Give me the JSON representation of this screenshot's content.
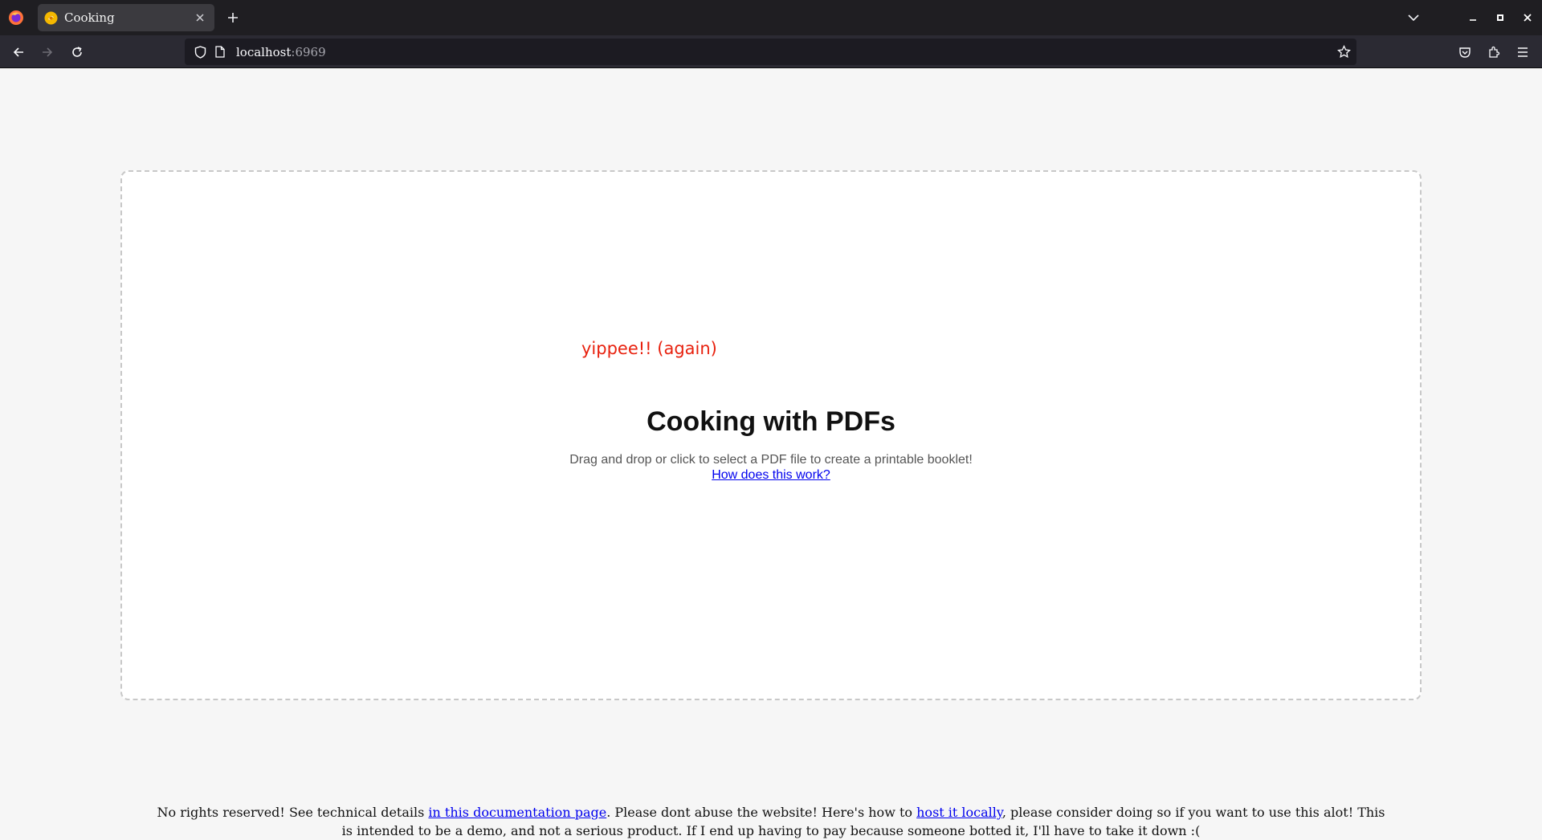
{
  "browser": {
    "tab": {
      "title": "Cooking"
    },
    "url": {
      "host": "localhost",
      "port": ":6969"
    },
    "icons": {
      "firefox_logo": "firefox-icon",
      "favicon": "cooking-favicon-icon",
      "close": "close-icon",
      "new_tab": "plus-icon",
      "tab_list": "chevron-down-icon",
      "back": "back-arrow-icon",
      "forward": "forward-arrow-icon",
      "reload": "reload-icon",
      "tracking": "shield-icon",
      "page": "page-icon",
      "bookmark": "star-icon",
      "pocket": "pocket-icon",
      "extensions": "puzzle-icon",
      "menu": "hamburger-menu-icon"
    }
  },
  "page": {
    "yippee": "yippee!! (again)",
    "title": "Cooking with PDFs",
    "subtitle": "Drag and drop or click to select a PDF file to create a printable booklet!",
    "how_link": "How does this work?",
    "footer": {
      "part1": "No rights reserved! See technical details ",
      "link1": "in this documentation page",
      "part2": ". Please dont abuse the website! Here's how to ",
      "link2": "host it locally",
      "part3": ", please consider doing so if you want to use this alot! This is intended to be a demo, and not a serious product. If I end up having to pay because someone botted it, I'll have to take it down :("
    }
  },
  "colors": {
    "accent_red": "#e8210e",
    "link": "#0000ee",
    "tab_bar": "#1f1e22",
    "nav_bar": "#2b2a33"
  }
}
